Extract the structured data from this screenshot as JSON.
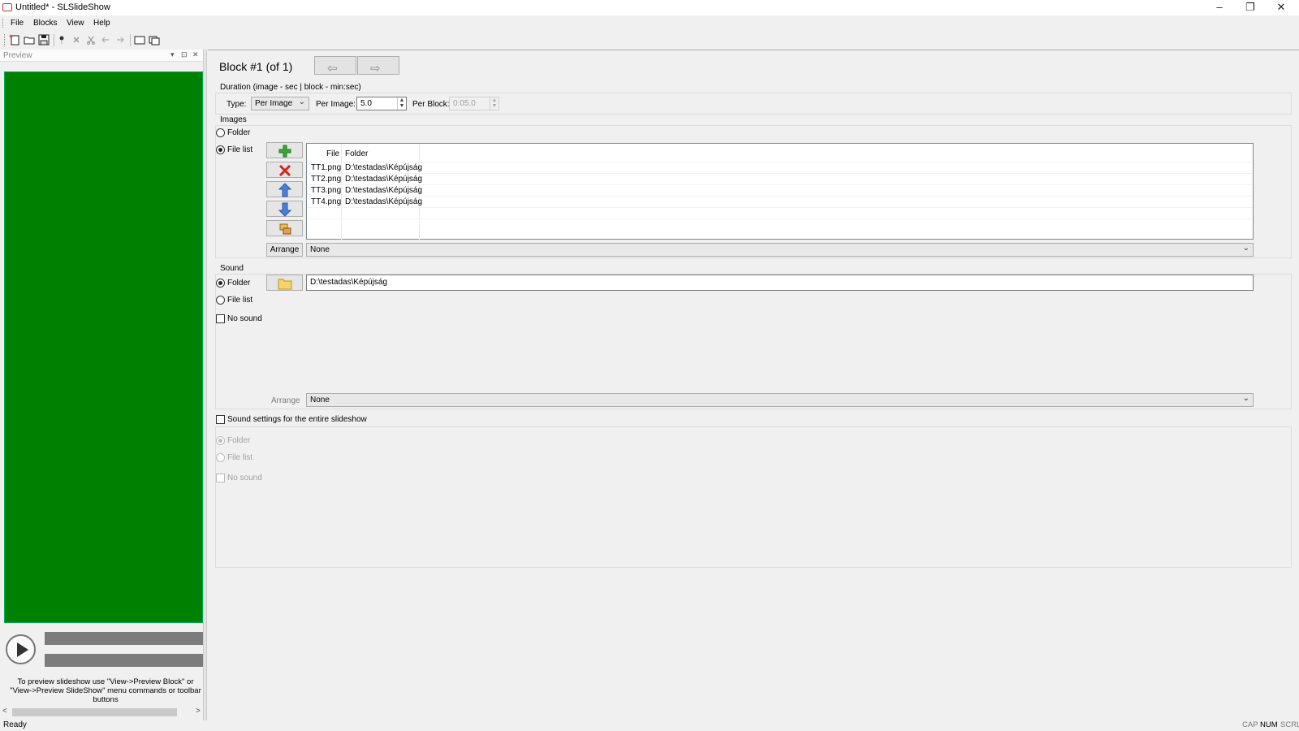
{
  "window": {
    "title": "Untitled* - SLSlideShow",
    "controls": [
      "–",
      "❐",
      "✕"
    ]
  },
  "menu": [
    "File",
    "Blocks",
    "View",
    "Help"
  ],
  "toolbar": {
    "icons": [
      "new-icon",
      "open-icon",
      "save-icon",
      "add-block-icon",
      "delete-block-icon",
      "cut-icon",
      "undo-icon",
      "redo-icon",
      "preview-block-icon",
      "preview-slideshow-icon"
    ]
  },
  "preview": {
    "title": "Preview",
    "dock_controls": [
      "▾",
      "⊡",
      "✕"
    ],
    "canvas_color": "#008000",
    "hint": "To preview slideshow use \"View->Preview Block\" or \"View->Preview SlideShow\" menu commands or toolbar buttons",
    "scroll_left": "<",
    "scroll_right": ">"
  },
  "block": {
    "title": "Block #1 (of 1)",
    "prev_arrow": "⇦",
    "next_arrow": "⇨"
  },
  "duration": {
    "group_label": "Duration (image - sec | block - min:sec)",
    "type_label": "Type:",
    "type_value": "Per Image",
    "per_image_label": "Per Image:",
    "per_image_value": "5.0",
    "per_block_label": "Per Block:",
    "per_block_value": "0:05.0"
  },
  "images": {
    "group_label": "Images",
    "folder_option": "Folder",
    "filelist_option": "File list",
    "selected": "File list",
    "columns": [
      "File",
      "Folder"
    ],
    "rows": [
      {
        "file": "TT1.png",
        "folder": "D:\\testadas\\Képújság"
      },
      {
        "file": "TT2.png",
        "folder": "D:\\testadas\\Képújság"
      },
      {
        "file": "TT3.png",
        "folder": "D:\\testadas\\Képújság"
      },
      {
        "file": "TT4.png",
        "folder": "D:\\testadas\\Képújság"
      }
    ],
    "arrange_label": "Arrange",
    "arrange_value": "None"
  },
  "sound": {
    "group_label": "Sound",
    "folder_option": "Folder",
    "filelist_option": "File list",
    "nosound_option": "No sound",
    "selected": "Folder",
    "folder_path": "D:\\testadas\\Képújság",
    "arrange_label": "Arrange",
    "arrange_value": "None"
  },
  "global_sound": {
    "checkbox_label": "Sound settings for the entire slideshow",
    "folder_option": "Folder",
    "filelist_option": "File list",
    "nosound_option": "No sound"
  },
  "status": {
    "text": "Ready",
    "indicators": [
      "CAP",
      "NUM",
      "SCRL"
    ]
  }
}
